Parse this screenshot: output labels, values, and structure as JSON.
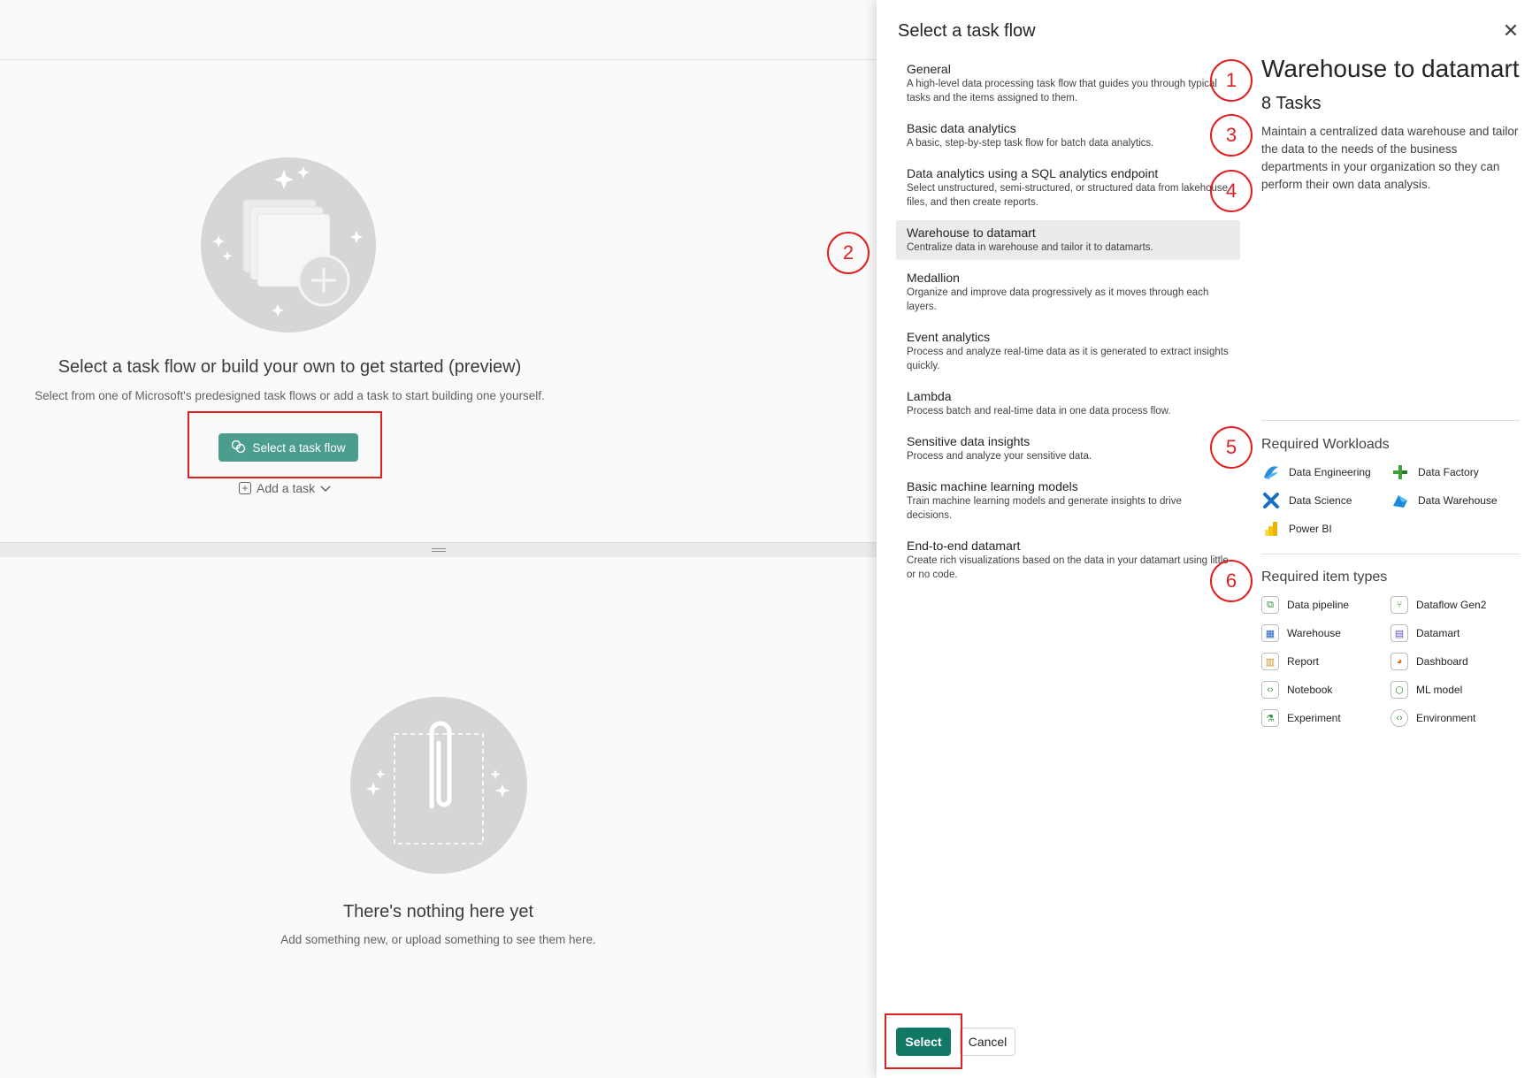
{
  "canvas": {
    "start_title": "Select a task flow or build your own to get started (preview)",
    "start_subtitle": "Select from one of Microsoft's predesigned task flows or add a task to start building one yourself.",
    "select_flow_button": "Select a task flow",
    "add_task_label": "Add a task",
    "empty_title": "There's nothing here yet",
    "empty_subtitle": "Add something new, or upload something to see them here."
  },
  "dialog": {
    "title": "Select a task flow",
    "close_glyph": "✕",
    "flows": [
      {
        "name": "General",
        "desc": "A high-level data processing task flow that guides you through typical tasks and the items assigned to them.",
        "selected": false
      },
      {
        "name": "Basic data analytics",
        "desc": "A basic, step-by-step task flow for batch data analytics.",
        "selected": false
      },
      {
        "name": "Data analytics using a SQL analytics endpoint",
        "desc": "Select unstructured, semi-structured, or structured data from lakehouse files, and then create reports.",
        "selected": false
      },
      {
        "name": "Warehouse to datamart",
        "desc": "Centralize data in warehouse and tailor it to datamarts.",
        "selected": true
      },
      {
        "name": "Medallion",
        "desc": "Organize and improve data progressively as it moves through each layers.",
        "selected": false
      },
      {
        "name": "Event analytics",
        "desc": "Process and analyze real-time data as it is generated to extract insights quickly.",
        "selected": false
      },
      {
        "name": "Lambda",
        "desc": "Process batch and real-time data in one data process flow.",
        "selected": false
      },
      {
        "name": "Sensitive data insights",
        "desc": "Process and analyze your sensitive data.",
        "selected": false
      },
      {
        "name": "Basic machine learning models",
        "desc": "Train machine learning models and generate insights to drive decisions.",
        "selected": false
      },
      {
        "name": "End-to-end datamart",
        "desc": "Create rich visualizations based on the data in your datamart using little or no code.",
        "selected": false
      }
    ],
    "detail": {
      "title": "Warehouse to datamart",
      "task_count": "8 Tasks",
      "description": "Maintain a centralized data warehouse and tailor the data to the needs of the business departments in your organization so they can perform their own data analysis.",
      "workloads_title": "Required Workloads",
      "workloads": [
        {
          "label": "Data Engineering",
          "icon": "data-engineering-icon",
          "color": "#2a8fd8"
        },
        {
          "label": "Data Factory",
          "icon": "data-factory-icon",
          "color": "#3aa335"
        },
        {
          "label": "Data Science",
          "icon": "data-science-icon",
          "color": "#1a6fc2"
        },
        {
          "label": "Data Warehouse",
          "icon": "data-warehouse-icon",
          "color": "#1c8ad6"
        },
        {
          "label": "Power BI",
          "icon": "power-bi-icon",
          "color": "#f2c811"
        }
      ],
      "item_types_title": "Required item types",
      "item_types": [
        {
          "label": "Data pipeline",
          "icon": "data-pipeline-icon",
          "color": "#2f8f3a"
        },
        {
          "label": "Dataflow Gen2",
          "icon": "dataflow-gen2-icon",
          "color": "#2f8f3a"
        },
        {
          "label": "Warehouse",
          "icon": "warehouse-icon",
          "color": "#1f5fbf"
        },
        {
          "label": "Datamart",
          "icon": "datamart-icon",
          "color": "#6b4fbb"
        },
        {
          "label": "Report",
          "icon": "report-icon",
          "color": "#c8951a"
        },
        {
          "label": "Dashboard",
          "icon": "dashboard-icon",
          "color": "#d9741a"
        },
        {
          "label": "Notebook",
          "icon": "notebook-icon",
          "color": "#2f8f3a"
        },
        {
          "label": "ML model",
          "icon": "ml-model-icon",
          "color": "#2f8f3a"
        },
        {
          "label": "Experiment",
          "icon": "experiment-icon",
          "color": "#2f8f3a"
        },
        {
          "label": "Environment",
          "icon": "environment-icon",
          "color": "#2f8f3a"
        }
      ]
    },
    "select_button": "Select",
    "cancel_button": "Cancel"
  },
  "markers": [
    "1",
    "2",
    "3",
    "4",
    "5",
    "6"
  ],
  "colors": {
    "accent": "#117865",
    "annotation": "#e02020",
    "selected_row": "#ebebeb"
  }
}
